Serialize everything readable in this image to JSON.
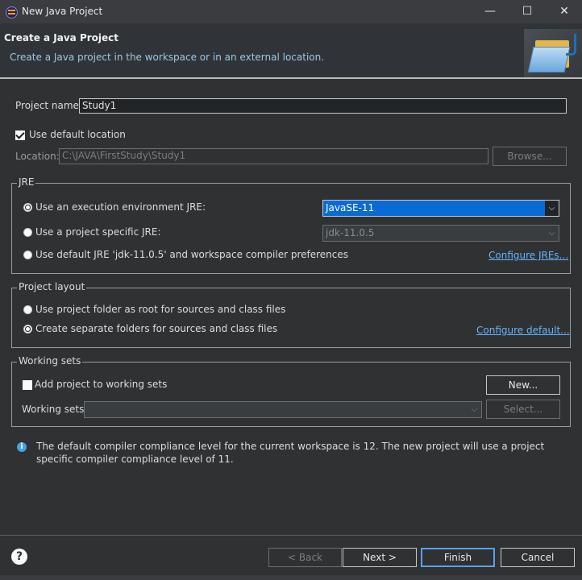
{
  "window": {
    "title": "New Java Project",
    "minimize": "—",
    "maximize": "☐",
    "close": "✕"
  },
  "header": {
    "title": "Create a Java Project",
    "description": "Create a Java project in the workspace or in an external location."
  },
  "project": {
    "name_label": "Project name:",
    "name_value": "Study1"
  },
  "location": {
    "use_default_label": "Use default location",
    "use_default_checked": true,
    "label": "Location:",
    "value": "C:\\JAVA\\FirstStudy\\Study1",
    "browse_label": "Browse..."
  },
  "jre": {
    "group_label": "JRE",
    "option_env_label": "Use an execution environment JRE:",
    "option_env_value": "JavaSE-11",
    "option_specific_label": "Use a project specific JRE:",
    "option_specific_value": "jdk-11.0.5",
    "option_default_label": "Use default JRE 'jdk-11.0.5' and workspace compiler preferences",
    "configure_link": "Configure JREs...",
    "selected": "env"
  },
  "layout": {
    "group_label": "Project layout",
    "option_root_label": "Use project folder as root for sources and class files",
    "option_separate_label": "Create separate folders for sources and class files",
    "configure_link": "Configure default...",
    "selected": "separate"
  },
  "working_sets": {
    "group_label": "Working sets",
    "add_label": "Add project to working sets",
    "add_checked": false,
    "new_label": "New...",
    "sets_label": "Working sets:",
    "sets_value": "",
    "select_label": "Select..."
  },
  "info": {
    "icon": "info-icon",
    "text": "The default compiler compliance level for the current workspace is 12. The new project will use a project specific compiler compliance level of 11."
  },
  "footer": {
    "help_icon": "help-icon",
    "back_label": "< Back",
    "next_label": "Next >",
    "finish_label": "Finish",
    "cancel_label": "Cancel"
  },
  "colors": {
    "background": "#2f3133",
    "link": "#66b3ff",
    "selection": "#0a6ad6",
    "accent": "#5aa0e8"
  }
}
